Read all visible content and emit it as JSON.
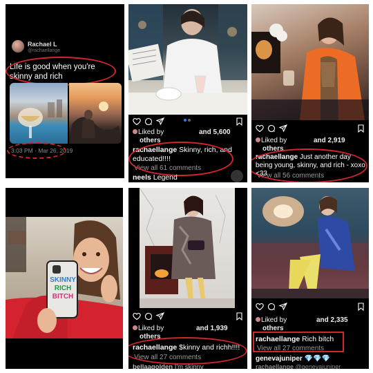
{
  "tweet": {
    "name": "Rachael L",
    "handle": "@rachaellange",
    "text": "Life is good when you're skinny and rich",
    "timestamp": "3:03 PM · Mar 26, 2019"
  },
  "posts": [
    {
      "liked_by": "Liked by",
      "others": "others",
      "likes_text": "and 5,600",
      "username": "rachaellange",
      "caption": "Skinny, rich, and educated!!!!",
      "view_comments": "View all 61 comments",
      "comment_user": "neels",
      "comment_text": "Legend"
    },
    {
      "liked_by": "Liked by",
      "others": "others",
      "likes_text": "and 2,919",
      "username": "rachaellange",
      "caption": "Just another day being young, skinny, and rich - xoxo <33",
      "view_comments": "View all 56 comments"
    },
    {
      "phone_case_text": [
        "SKINNY",
        "RICH",
        "BITCH"
      ]
    },
    {
      "liked_by": "Liked by",
      "others": "others",
      "likes_text": "and 1,939",
      "username": "rachaellange",
      "caption": "$kinny and richh!!!!",
      "view_comments": "View all 27 comments",
      "comment_user": "bellaagolden",
      "comment_text": "I'm skinny"
    },
    {
      "liked_by": "Liked by",
      "others": "others",
      "likes_text": "and 2,335",
      "username": "rachaellange",
      "caption": "Rich bitch",
      "view_comments": "View all 27 comments",
      "comment_user": "genevajuniper",
      "comment_text": "💎💎💎",
      "comment2_user": "rachaellange",
      "comment2_text": "@genevajuniper"
    }
  ],
  "colors": {
    "highlight": "#d3262b",
    "panel_bg": "#000000",
    "muted_text": "#9a9a9a"
  },
  "icons": [
    "heart-icon",
    "comment-icon",
    "share-icon",
    "bookmark-icon",
    "avatar"
  ]
}
